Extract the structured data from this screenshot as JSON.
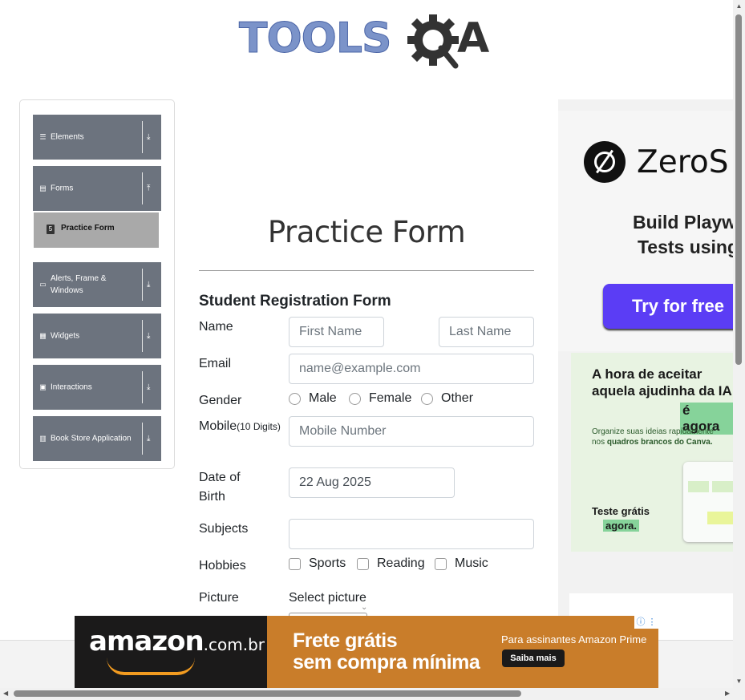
{
  "logo": {
    "part1": "TOOLS",
    "part2": "A"
  },
  "nav": {
    "groups": [
      {
        "label": "Elements",
        "icon": "list-icon"
      },
      {
        "label": "Forms",
        "icon": "form-icon"
      },
      {
        "label": "Alerts, Frame & Windows",
        "icon": "window-icon"
      },
      {
        "label": "Widgets",
        "icon": "widgets-icon"
      },
      {
        "label": "Interactions",
        "icon": "interactions-icon"
      },
      {
        "label": "Book Store Application",
        "icon": "book-icon"
      }
    ],
    "active_subitem": "Practice Form"
  },
  "form": {
    "title": "Practice Form",
    "heading": "Student Registration Form",
    "name_label": "Name",
    "first_name_placeholder": "First Name",
    "last_name_placeholder": "Last Name",
    "email_label": "Email",
    "email_placeholder": "name@example.com",
    "gender_label": "Gender",
    "gender_options": [
      "Male",
      "Female",
      "Other"
    ],
    "mobile_label": "Mobile",
    "mobile_hint": "(10 Digits)",
    "mobile_placeholder": "Mobile Number",
    "dob_label_1": "Date of",
    "dob_label_2": "Birth",
    "dob_value": "22 Aug 2025",
    "subjects_label": "Subjects",
    "hobbies_label": "Hobbies",
    "hobbies": [
      "Sports",
      "Reading",
      "Music"
    ],
    "picture_label": "Picture",
    "picture_text": "Select picture"
  },
  "side_ad": {
    "brand": "ZeroS",
    "line1": "Build Playwr",
    "line2": "Tests using",
    "cta": "Try for free",
    "canva_h1": "A hora de aceitar",
    "canva_h2": "aquela ajudinha da IA",
    "canva_highlight": "é agora",
    "canva_p1": "Organize suas ideias rapidamente",
    "canva_p2_prefix": "nos ",
    "canva_p2_bold": "quadros brancos do Canva.",
    "canva_cta1": "Teste grátis",
    "canva_cta2": "agora."
  },
  "bottom_ad": {
    "brand": "amazon",
    "domain": ".com.br",
    "headline1": "Frete grátis",
    "headline2": "sem compra mínima",
    "prime_text": "Para assinantes Amazon Prime",
    "cta": "Saiba mais"
  },
  "colors": {
    "nav_bg": "#6c737e",
    "subitem_bg": "#a9a9a9",
    "accent": "#5b3df5",
    "amazon_orange": "#c97d2a"
  }
}
